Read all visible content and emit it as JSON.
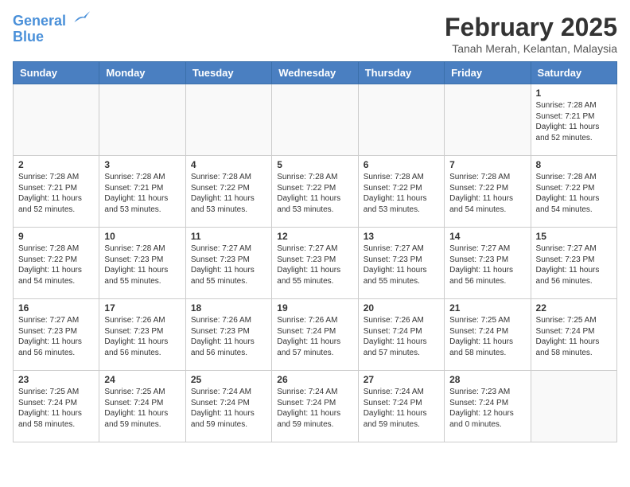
{
  "header": {
    "logo_line1": "General",
    "logo_line2": "Blue",
    "month_title": "February 2025",
    "subtitle": "Tanah Merah, Kelantan, Malaysia"
  },
  "days_of_week": [
    "Sunday",
    "Monday",
    "Tuesday",
    "Wednesday",
    "Thursday",
    "Friday",
    "Saturday"
  ],
  "weeks": [
    [
      {
        "day": "",
        "info": ""
      },
      {
        "day": "",
        "info": ""
      },
      {
        "day": "",
        "info": ""
      },
      {
        "day": "",
        "info": ""
      },
      {
        "day": "",
        "info": ""
      },
      {
        "day": "",
        "info": ""
      },
      {
        "day": "1",
        "info": "Sunrise: 7:28 AM\nSunset: 7:21 PM\nDaylight: 11 hours\nand 52 minutes."
      }
    ],
    [
      {
        "day": "2",
        "info": "Sunrise: 7:28 AM\nSunset: 7:21 PM\nDaylight: 11 hours\nand 52 minutes."
      },
      {
        "day": "3",
        "info": "Sunrise: 7:28 AM\nSunset: 7:21 PM\nDaylight: 11 hours\nand 53 minutes."
      },
      {
        "day": "4",
        "info": "Sunrise: 7:28 AM\nSunset: 7:22 PM\nDaylight: 11 hours\nand 53 minutes."
      },
      {
        "day": "5",
        "info": "Sunrise: 7:28 AM\nSunset: 7:22 PM\nDaylight: 11 hours\nand 53 minutes."
      },
      {
        "day": "6",
        "info": "Sunrise: 7:28 AM\nSunset: 7:22 PM\nDaylight: 11 hours\nand 53 minutes."
      },
      {
        "day": "7",
        "info": "Sunrise: 7:28 AM\nSunset: 7:22 PM\nDaylight: 11 hours\nand 54 minutes."
      },
      {
        "day": "8",
        "info": "Sunrise: 7:28 AM\nSunset: 7:22 PM\nDaylight: 11 hours\nand 54 minutes."
      }
    ],
    [
      {
        "day": "9",
        "info": "Sunrise: 7:28 AM\nSunset: 7:22 PM\nDaylight: 11 hours\nand 54 minutes."
      },
      {
        "day": "10",
        "info": "Sunrise: 7:28 AM\nSunset: 7:23 PM\nDaylight: 11 hours\nand 55 minutes."
      },
      {
        "day": "11",
        "info": "Sunrise: 7:27 AM\nSunset: 7:23 PM\nDaylight: 11 hours\nand 55 minutes."
      },
      {
        "day": "12",
        "info": "Sunrise: 7:27 AM\nSunset: 7:23 PM\nDaylight: 11 hours\nand 55 minutes."
      },
      {
        "day": "13",
        "info": "Sunrise: 7:27 AM\nSunset: 7:23 PM\nDaylight: 11 hours\nand 55 minutes."
      },
      {
        "day": "14",
        "info": "Sunrise: 7:27 AM\nSunset: 7:23 PM\nDaylight: 11 hours\nand 56 minutes."
      },
      {
        "day": "15",
        "info": "Sunrise: 7:27 AM\nSunset: 7:23 PM\nDaylight: 11 hours\nand 56 minutes."
      }
    ],
    [
      {
        "day": "16",
        "info": "Sunrise: 7:27 AM\nSunset: 7:23 PM\nDaylight: 11 hours\nand 56 minutes."
      },
      {
        "day": "17",
        "info": "Sunrise: 7:26 AM\nSunset: 7:23 PM\nDaylight: 11 hours\nand 56 minutes."
      },
      {
        "day": "18",
        "info": "Sunrise: 7:26 AM\nSunset: 7:23 PM\nDaylight: 11 hours\nand 56 minutes."
      },
      {
        "day": "19",
        "info": "Sunrise: 7:26 AM\nSunset: 7:24 PM\nDaylight: 11 hours\nand 57 minutes."
      },
      {
        "day": "20",
        "info": "Sunrise: 7:26 AM\nSunset: 7:24 PM\nDaylight: 11 hours\nand 57 minutes."
      },
      {
        "day": "21",
        "info": "Sunrise: 7:25 AM\nSunset: 7:24 PM\nDaylight: 11 hours\nand 58 minutes."
      },
      {
        "day": "22",
        "info": "Sunrise: 7:25 AM\nSunset: 7:24 PM\nDaylight: 11 hours\nand 58 minutes."
      }
    ],
    [
      {
        "day": "23",
        "info": "Sunrise: 7:25 AM\nSunset: 7:24 PM\nDaylight: 11 hours\nand 58 minutes."
      },
      {
        "day": "24",
        "info": "Sunrise: 7:25 AM\nSunset: 7:24 PM\nDaylight: 11 hours\nand 59 minutes."
      },
      {
        "day": "25",
        "info": "Sunrise: 7:24 AM\nSunset: 7:24 PM\nDaylight: 11 hours\nand 59 minutes."
      },
      {
        "day": "26",
        "info": "Sunrise: 7:24 AM\nSunset: 7:24 PM\nDaylight: 11 hours\nand 59 minutes."
      },
      {
        "day": "27",
        "info": "Sunrise: 7:24 AM\nSunset: 7:24 PM\nDaylight: 11 hours\nand 59 minutes."
      },
      {
        "day": "28",
        "info": "Sunrise: 7:23 AM\nSunset: 7:24 PM\nDaylight: 12 hours\nand 0 minutes."
      },
      {
        "day": "",
        "info": ""
      }
    ]
  ]
}
